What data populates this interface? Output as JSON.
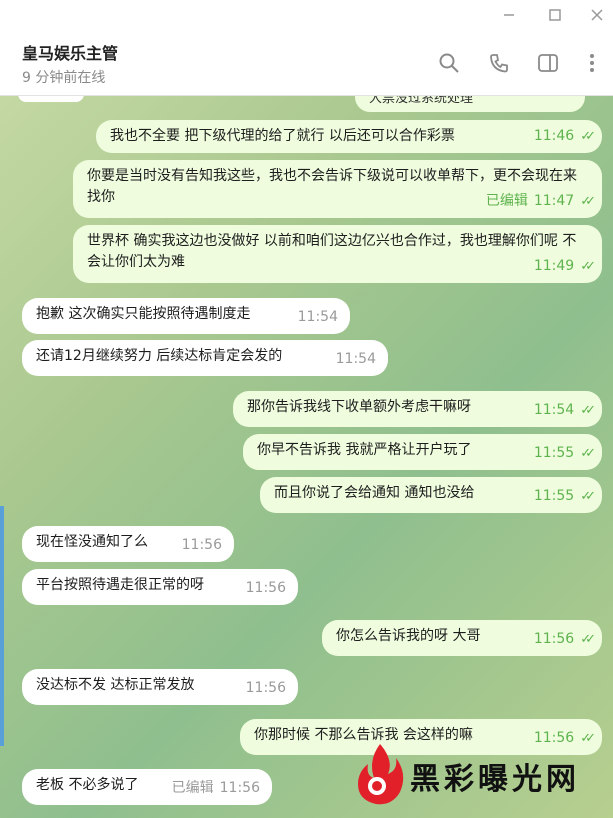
{
  "window": {
    "minimize_icon": "minimize-icon",
    "maximize_icon": "maximize-icon",
    "close_icon": "close-icon"
  },
  "header": {
    "title": "皇马娱乐主管",
    "status": "9 分钟前在线",
    "icons": [
      "search-icon",
      "phone-icon",
      "sidebar-icon",
      "more-icon"
    ]
  },
  "messages": [
    {
      "dir": "out",
      "text": "我也不全要 把下级代理的给了就行 以后还可以合作彩票",
      "time": "11:46",
      "edited": ""
    },
    {
      "dir": "out",
      "text": "你要是当时没有告知我这些，我也不会告诉下级说可以收单帮下，更不会现在来找你",
      "time": "11:47",
      "edited": "已编辑"
    },
    {
      "dir": "out",
      "text": "世界杯 确实我这边也没做好 以前和咱们这边亿兴也合作过，我也理解你们呢 不会让你们太为难",
      "time": "11:49",
      "edited": ""
    },
    {
      "dir": "in",
      "text": "抱歉 这次确实只能按照待遇制度走",
      "time": "11:54",
      "edited": ""
    },
    {
      "dir": "in",
      "text": "还请12月继续努力 后续达标肯定会发的",
      "time": "11:54",
      "edited": ""
    },
    {
      "dir": "out",
      "text": "那你告诉我线下收单额外考虑干嘛呀",
      "time": "11:54",
      "edited": ""
    },
    {
      "dir": "out",
      "text": "你早不告诉我 我就严格让开户玩了",
      "time": "11:55",
      "edited": ""
    },
    {
      "dir": "out",
      "text": "而且你说了会给通知 通知也没给",
      "time": "11:55",
      "edited": ""
    },
    {
      "dir": "in",
      "text": "现在怪没通知了么",
      "time": "11:56",
      "edited": ""
    },
    {
      "dir": "in",
      "text": "平台按照待遇走很正常的呀",
      "time": "11:56",
      "edited": ""
    },
    {
      "dir": "out",
      "text": "你怎么告诉我的呀 大哥",
      "time": "11:56",
      "edited": ""
    },
    {
      "dir": "in",
      "text": "没达标不发  达标正常发放",
      "time": "11:56",
      "edited": ""
    },
    {
      "dir": "out",
      "text": "你那时候 不那么告诉我 会这样的嘛",
      "time": "11:56",
      "edited": ""
    },
    {
      "dir": "in",
      "text": "老板 不必多说了",
      "time": "11:56",
      "edited": "已编辑"
    }
  ],
  "partial_top_text": "大票没过系统处理",
  "watermark": {
    "text": "黑彩曝光网",
    "logo": "flame-logo"
  },
  "colors": {
    "outgoing": "#effdde",
    "incoming": "#ffffff",
    "accent": "#5fb34f"
  }
}
